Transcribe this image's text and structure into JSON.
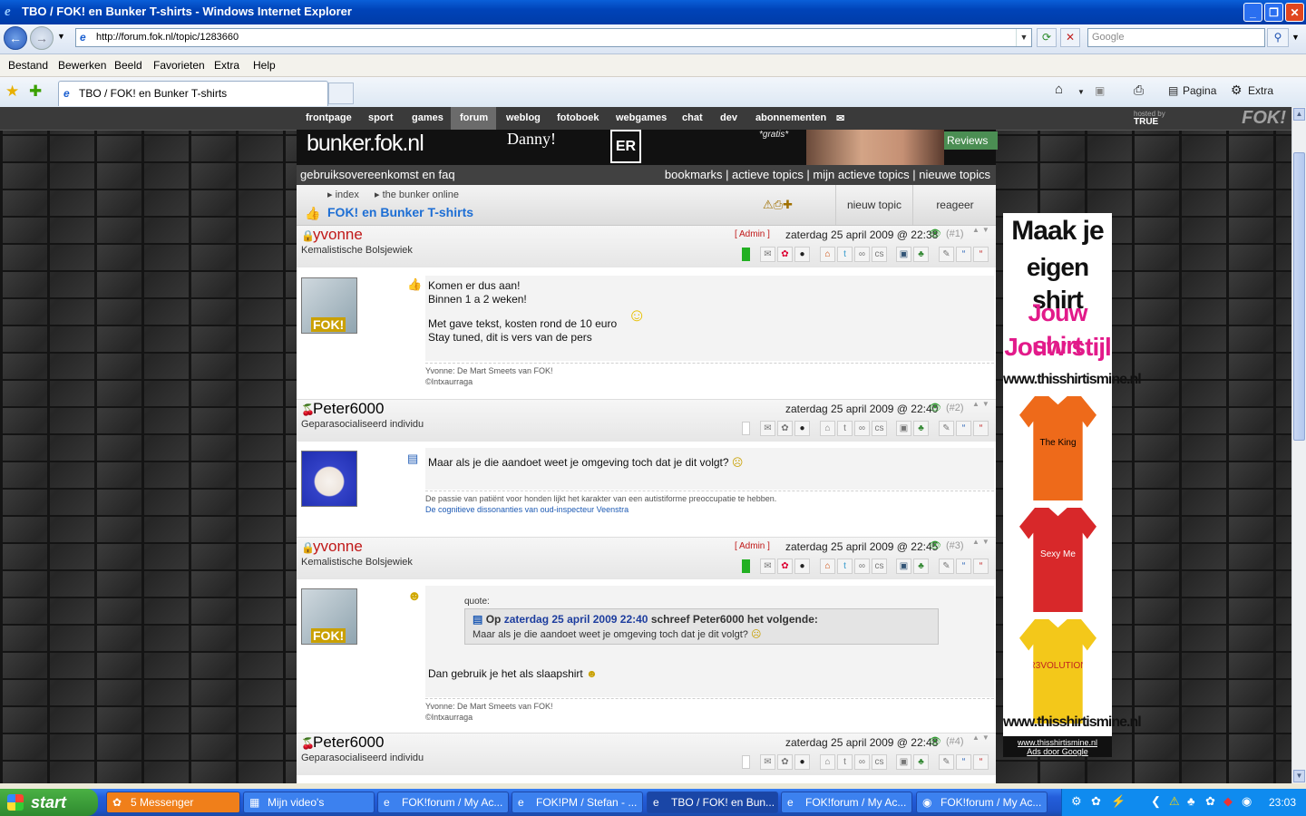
{
  "window": {
    "title": "TBO / FOK! en Bunker T-shirts - Windows Internet Explorer"
  },
  "address": {
    "url": "http://forum.fok.nl/topic/1283660",
    "search_placeholder": "Google"
  },
  "menu": [
    "Bestand",
    "Bewerken",
    "Beeld",
    "Favorieten",
    "Extra",
    "Help"
  ],
  "tab": {
    "label": "TBO / FOK! en Bunker T-shirts"
  },
  "toolbar": {
    "pagina": "Pagina",
    "extra": "Extra"
  },
  "topnav": [
    "frontpage",
    "sport",
    "games",
    "forum",
    "weblog",
    "fotoboek",
    "webgames",
    "chat",
    "dev",
    "abonnementen"
  ],
  "hosted": "hosted by",
  "hosted_brand": "TRUE",
  "header": {
    "logo": "bunker.fok.nl",
    "danny": "Danny!",
    "er": "ER",
    "gratis": "*gratis*",
    "reviews": "Reviews"
  },
  "linkbar": {
    "left": "gebruiksovereenkomst en faq",
    "right": "bookmarks | actieve topics | mijn actieve topics | nieuwe topics"
  },
  "breadcrumbs": {
    "index": "index",
    "section": "the bunker online",
    "topic": "FOK! en Bunker T-shirts",
    "new_topic": "nieuw topic",
    "reply": "reageer"
  },
  "posts": [
    {
      "user": "yvonne",
      "title": "Kemalistische Bolsjewiek",
      "badge": "[ Admin ]",
      "date": "zaterdag 25 april 2009 @ 22:38",
      "num": "(#1)",
      "lines": [
        "Komen er dus aan!",
        "Binnen 1 a 2 weken!",
        "Met gave tekst, kosten rond de 10 euro",
        "Stay tuned, dit is vers van de pers"
      ],
      "sig": [
        "Yvonne: De Mart Smeets van FOK!",
        "©Intxaurraga"
      ]
    },
    {
      "user": "Peter6000",
      "title": "Geparasocialiseerd individu",
      "date": "zaterdag 25 april 2009 @ 22:40",
      "num": "(#2)",
      "lines": [
        "Maar als je die aandoet weet je omgeving toch dat je dit volgt?"
      ],
      "sig": [
        "De passie van patiënt voor honden lijkt het karakter van een autistiforme preoccupatie te hebben.",
        "De cognitieve dissonanties van oud-inspecteur Veenstra"
      ]
    },
    {
      "user": "yvonne",
      "title": "Kemalistische Bolsjewiek",
      "badge": "[ Admin ]",
      "date": "zaterdag 25 april 2009 @ 22:45",
      "num": "(#3)",
      "quote": {
        "label": "quote:",
        "prefix": "Op",
        "date": "zaterdag 25 april 2009 22:40",
        "suffix": "schreef Peter6000 het volgende:",
        "text": "Maar als je die aandoet weet je omgeving toch dat je dit volgt?"
      },
      "lines": [
        "Dan gebruik je het als slaapshirt"
      ],
      "sig": [
        "Yvonne: De Mart Smeets van FOK!",
        "©Intxaurraga"
      ]
    },
    {
      "user": "Peter6000",
      "title": "Geparasocialiseerd individu",
      "date": "zaterdag 25 april 2009 @ 22:48",
      "num": "(#4)"
    }
  ],
  "ad": {
    "line1": "Maak je",
    "line2": "eigen shirt",
    "line3": "Jouw shirt",
    "line4": "Jouw stijl",
    "url": "www.thisshirtismine.nl",
    "shirt1": "The King",
    "shirt2": "Sexy Me",
    "shirt3": "R3VOLUTION",
    "url2": "www.thisshirtismine.nl",
    "foot_url": "www.thisshirtismine.nl",
    "foot": "Ads door Google"
  },
  "taskbar": {
    "start": "start",
    "clock": "23:03",
    "tasks": [
      "5 Messenger",
      "Mijn video's",
      "FOK!forum / My Ac...",
      "FOK!PM / Stefan - ...",
      "TBO / FOK! en Bun...",
      "FOK!forum / My Ac...",
      "FOK!forum / My Ac..."
    ]
  },
  "colors": {
    "admin_red": "#c01818",
    "link_blue": "#1d6ed4",
    "online_green": "#22b022"
  }
}
